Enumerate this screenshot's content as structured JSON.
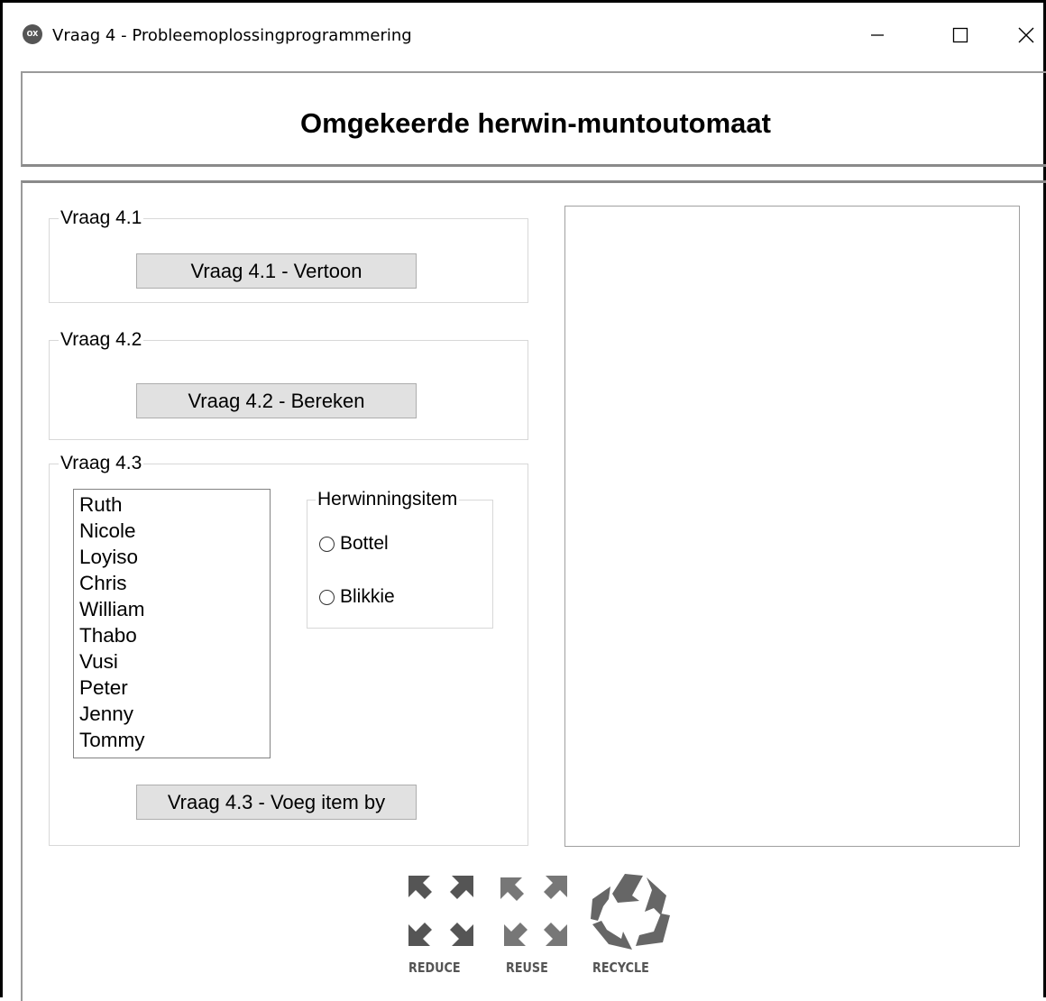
{
  "window": {
    "title": "Vraag 4 - Probleemoplossingprogrammering",
    "app_icon_text": "OX",
    "controls": [
      "minimize",
      "maximize",
      "close"
    ]
  },
  "header": {
    "title": "Omgekeerde herwin-muntoutomaat"
  },
  "groups": {
    "q41": {
      "legend": "Vraag 4.1",
      "button": "Vraag 4.1 - Vertoon"
    },
    "q42": {
      "legend": "Vraag 4.2",
      "button": "Vraag 4.2 - Bereken"
    },
    "q43": {
      "legend": "Vraag 4.3",
      "names": [
        "Ruth",
        "Nicole",
        "Loyiso",
        "Chris",
        "William",
        "Thabo",
        "Vusi",
        "Peter",
        "Jenny",
        "Tommy"
      ],
      "radio_group": {
        "legend": "Herwinningsitem",
        "options": [
          "Bottel",
          "Blikkie"
        ],
        "selected": null
      },
      "button": "Vraag 4.3 - Voeg item by"
    }
  },
  "output": {
    "text": ""
  },
  "logo": {
    "captions": [
      "REDUCE",
      "REUSE",
      "RECYCLE"
    ]
  },
  "colors": {
    "button_face": "#e1e1e1",
    "group_border": "#d8d8d8",
    "logo_gray": "#555555"
  }
}
